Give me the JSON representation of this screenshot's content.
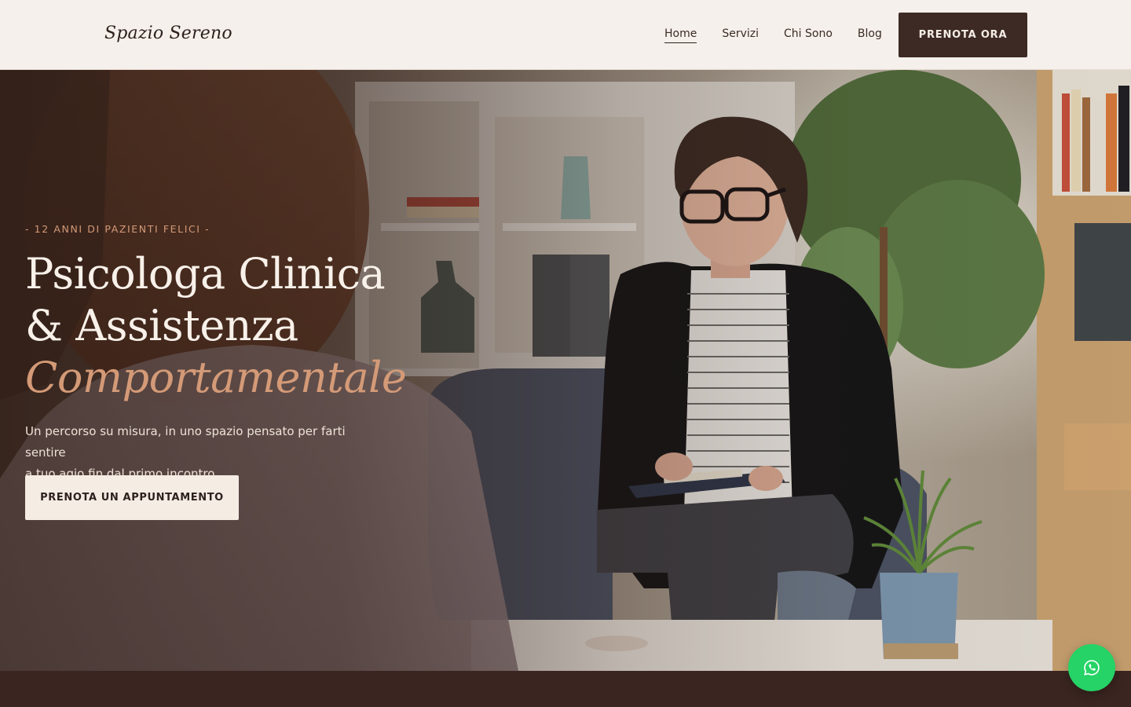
{
  "brand": {
    "name": "Spazio Sereno"
  },
  "nav": {
    "items": [
      {
        "label": "Home",
        "active": true
      },
      {
        "label": "Servizi",
        "active": false
      },
      {
        "label": "Chi Sono",
        "active": false
      },
      {
        "label": "Blog",
        "active": false
      }
    ],
    "cta_label": "PRENOTA ORA"
  },
  "hero": {
    "eyebrow": "- 12 ANNI DI PAZIENTI FELICI -",
    "title_line1": "Psicologa Clinica",
    "title_line2": "& Assistenza",
    "title_accent": "Comportamentale",
    "subtitle_line1": "Un percorso su misura, in uno spazio pensato per farti sentire",
    "subtitle_line2": "a tuo agio fin dal primo incontro.",
    "cta_label": "PRENOTA UN APPUNTAMENTO",
    "background_image": "therapy-session-photo"
  },
  "floating": {
    "icon": "whatsapp-icon"
  },
  "colors": {
    "header_bg": "#f5f0eb",
    "primary_dark": "#3d2a25",
    "accent": "#d49a77",
    "cta_light": "#f5ece4",
    "whatsapp_green": "#25d366"
  }
}
